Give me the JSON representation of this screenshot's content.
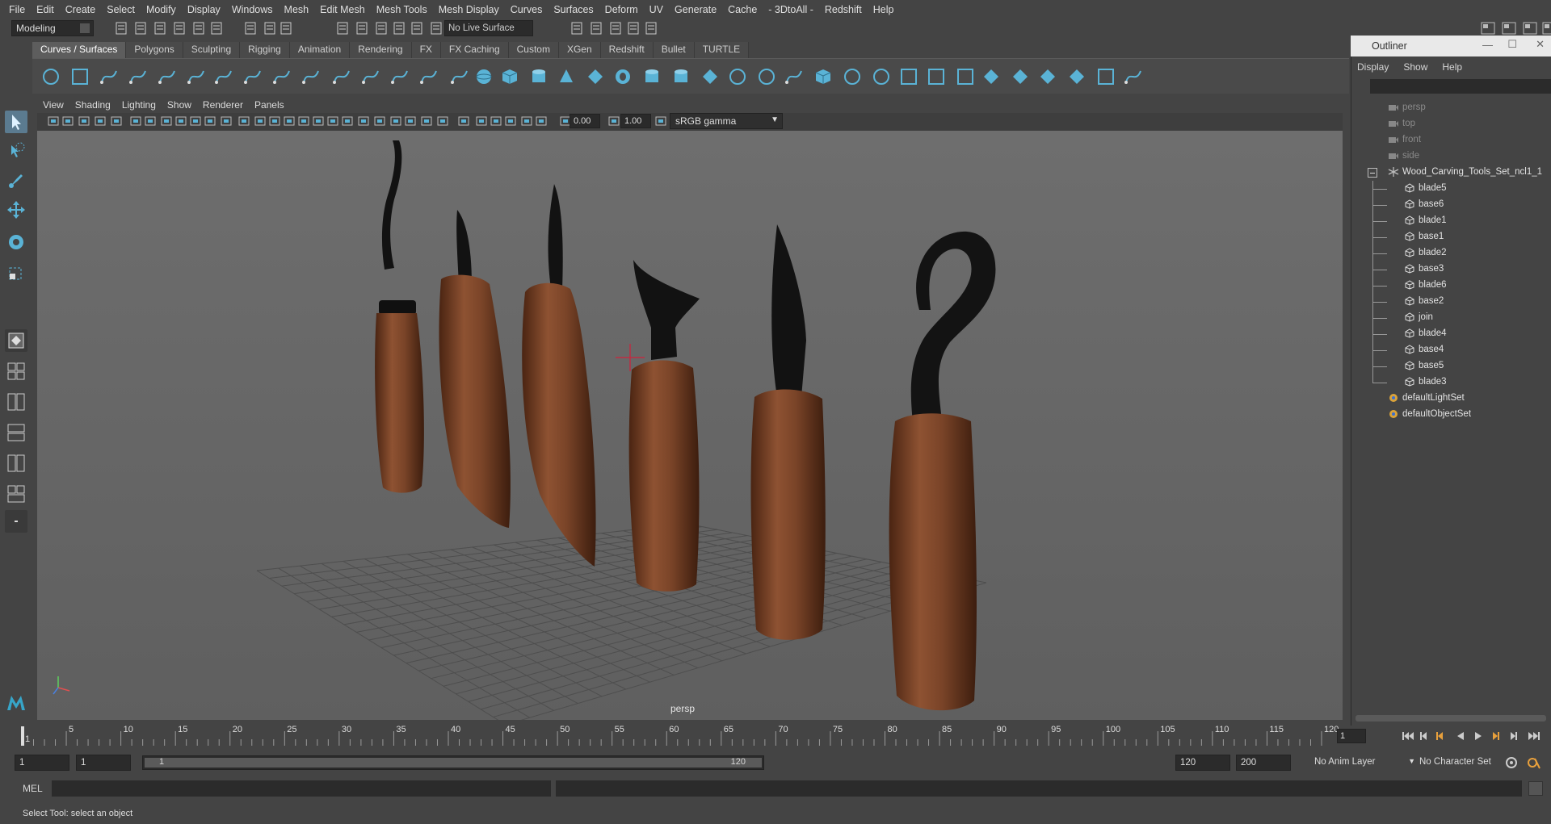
{
  "menubar": [
    "File",
    "Edit",
    "Create",
    "Select",
    "Modify",
    "Display",
    "Windows",
    "Mesh",
    "Edit Mesh",
    "Mesh Tools",
    "Mesh Display",
    "Curves",
    "Surfaces",
    "Deform",
    "UV",
    "Generate",
    "Cache",
    "- 3DtoAll -",
    "Redshift",
    "Help"
  ],
  "status": {
    "mode": "Modeling",
    "live_surface": "No Live Surface"
  },
  "shelf_tabs": [
    "Curves / Surfaces",
    "Polygons",
    "Sculpting",
    "Rigging",
    "Animation",
    "Rendering",
    "FX",
    "FX Caching",
    "Custom",
    "XGen",
    "Redshift",
    "Bullet",
    "TURTLE"
  ],
  "shelf_active": "Curves / Surfaces",
  "viewport_menu": [
    "View",
    "Shading",
    "Lighting",
    "Show",
    "Renderer",
    "Panels"
  ],
  "viewport_fields": {
    "exposure": "0.00",
    "gamma_value": "1.00",
    "color_space": "sRGB gamma"
  },
  "viewport_label": "persp",
  "outliner": {
    "title": "Outliner",
    "menu": [
      "Display",
      "Show",
      "Help"
    ],
    "cameras": [
      "persp",
      "top",
      "front",
      "side"
    ],
    "group": "Wood_Carving_Tools_Set_ncl1_1",
    "children": [
      "blade5",
      "base6",
      "blade1",
      "base1",
      "blade2",
      "base3",
      "blade6",
      "base2",
      "join",
      "blade4",
      "base4",
      "base5",
      "blade3"
    ],
    "sets": [
      "defaultLightSet",
      "defaultObjectSet"
    ]
  },
  "timeline": {
    "ticks": [
      "1",
      "5",
      "10",
      "15",
      "20",
      "25",
      "30",
      "35",
      "40",
      "45",
      "50",
      "55",
      "60",
      "65",
      "70",
      "75",
      "80",
      "85",
      "90",
      "95",
      "100",
      "105",
      "110",
      "115",
      "120"
    ],
    "current_frame": "1"
  },
  "range": {
    "start": "1",
    "playback_start": "1",
    "slider_start": "1",
    "slider_end": "120",
    "playback_end": "120",
    "end": "200",
    "anim_layer": "No Anim Layer",
    "character_set": "No Character Set"
  },
  "cmd_label": "MEL",
  "help_text": "Select Tool: select an object",
  "colors": {
    "bg": "#444444",
    "viewport": "#6b6b6b",
    "accent": "#5ab3d6",
    "wood": "#7a4428",
    "blade": "#151515"
  }
}
